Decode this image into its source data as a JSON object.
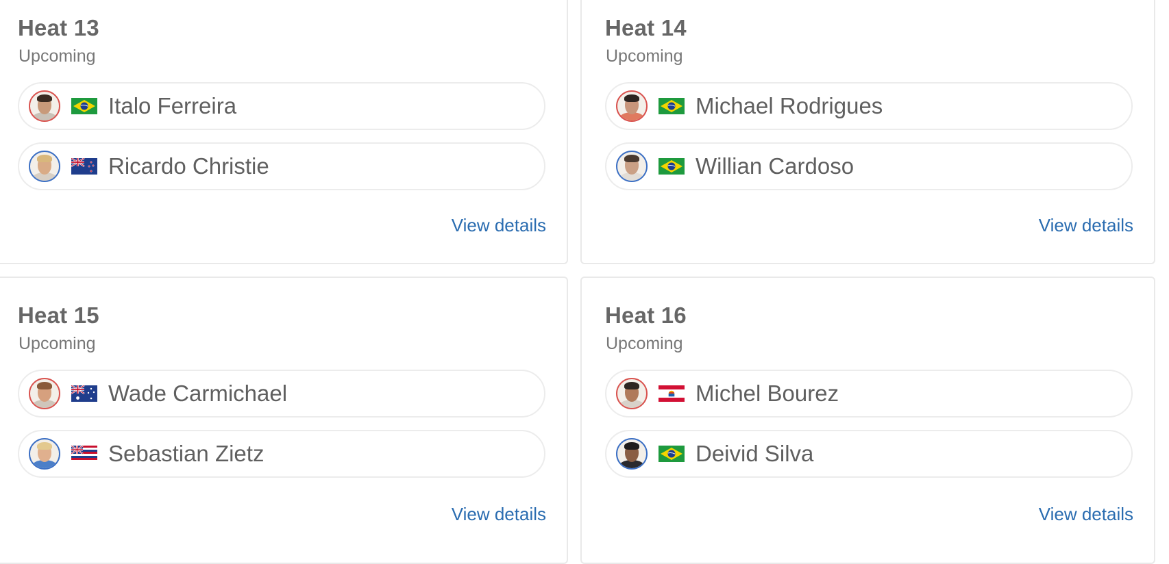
{
  "heats": [
    {
      "title": "Heat 13",
      "status": "Upcoming",
      "athletes": [
        {
          "name": "Italo Ferreira",
          "flag": "brazil-flag",
          "jersey": "red"
        },
        {
          "name": "Ricardo Christie",
          "flag": "new-zealand-flag",
          "jersey": "blue"
        }
      ],
      "link": "View details"
    },
    {
      "title": "Heat 14",
      "status": "Upcoming",
      "athletes": [
        {
          "name": "Michael Rodrigues",
          "flag": "brazil-flag",
          "jersey": "red"
        },
        {
          "name": "Willian Cardoso",
          "flag": "brazil-flag",
          "jersey": "blue"
        }
      ],
      "link": "View details"
    },
    {
      "title": "Heat 15",
      "status": "Upcoming",
      "athletes": [
        {
          "name": "Wade Carmichael",
          "flag": "australia-flag",
          "jersey": "red"
        },
        {
          "name": "Sebastian Zietz",
          "flag": "hawaii-flag",
          "jersey": "blue"
        }
      ],
      "link": "View details"
    },
    {
      "title": "Heat 16",
      "status": "Upcoming",
      "athletes": [
        {
          "name": "Michel Bourez",
          "flag": "french-polynesia-flag",
          "jersey": "red"
        },
        {
          "name": "Deivid Silva",
          "flag": "brazil-flag",
          "jersey": "blue"
        }
      ],
      "link": "View details"
    }
  ],
  "colors": {
    "link": "#2a6cb0",
    "jersey_red": "#d9534f",
    "jersey_blue": "#3b6fc4"
  }
}
